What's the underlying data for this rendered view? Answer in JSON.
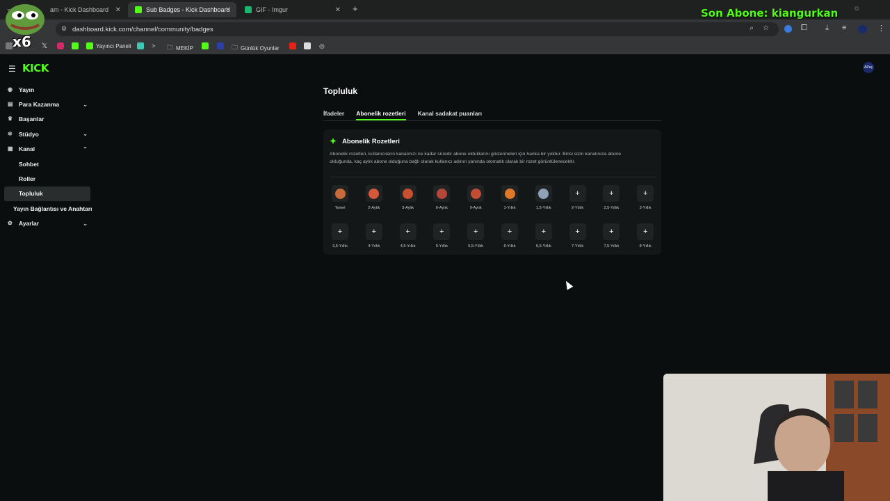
{
  "browser": {
    "tabs": [
      {
        "title": "am - Kick Dashboard",
        "active": false,
        "favicon_color": "#53fc18"
      },
      {
        "title": "Sub Badges - Kick Dashboard",
        "active": true,
        "favicon_color": "#53fc18"
      },
      {
        "title": "GIF - Imgur",
        "active": false,
        "favicon_color": "#1bb76e"
      }
    ],
    "new_tab": "+",
    "url": "dashboard.kick.com/channel/community/badges",
    "bookmarks": [
      {
        "label": "Yayıncı Paneli",
        "icon": "kick-icon"
      },
      {
        "label": "MEKİP",
        "icon": "folder-icon"
      },
      {
        "label": "Günlük Oyunlar",
        "icon": "folder-icon"
      }
    ]
  },
  "overlay": {
    "last_sub": "Son Abone: kiangurkan",
    "multiplier": "x6"
  },
  "app": {
    "brand": "KICK",
    "avatar_text": "APeç"
  },
  "sidebar": {
    "items": [
      {
        "label": "Yayın",
        "icon": "broadcast-icon",
        "chevron": ""
      },
      {
        "label": "Para Kazanma",
        "icon": "money-icon",
        "chevron": "⌄"
      },
      {
        "label": "Başarılar",
        "icon": "trophy-icon",
        "chevron": ""
      },
      {
        "label": "Stüdyo",
        "icon": "studio-icon",
        "chevron": "⌄"
      },
      {
        "label": "Kanal",
        "icon": "channel-icon",
        "chevron": "⌃"
      },
      {
        "label": "Sohbet"
      },
      {
        "label": "Roller"
      },
      {
        "label": "Topluluk"
      },
      {
        "label": "Yayın Bağlantısı ve Anahtarı"
      },
      {
        "label": "Ayarlar",
        "icon": "gear-icon",
        "chevron": "⌄"
      }
    ]
  },
  "main": {
    "title": "Topluluk",
    "tabs": [
      "İfadeler",
      "Abonelik rozetleri",
      "Kanal sadakat puanları"
    ],
    "active_tab": "Abonelik rozetleri",
    "card": {
      "title": "Abonelik Rozetleri",
      "description": "Abonelik rozetleri, kullanıcıların kanalınızı ne kadar süredir abone olduklarını göstermeleri için harika bir yoldur. Birisi sizin kanalınıza abone olduğunda, kaç aylık abone olduğuna bağlı olarak kullanıcı adının yanında otomatik olarak bir rozet görüntülenecektir."
    },
    "badges_row1": [
      {
        "label": "Temel",
        "filled": true,
        "color": "#c96a3a"
      },
      {
        "label": "2-Aylık",
        "filled": true,
        "color": "#d4593a"
      },
      {
        "label": "3-Aylık",
        "filled": true,
        "color": "#c94f2e"
      },
      {
        "label": "6-Aylık",
        "filled": true,
        "color": "#b4483b"
      },
      {
        "label": "9-Aylık",
        "filled": true,
        "color": "#c24c34"
      },
      {
        "label": "1-Yıllık",
        "filled": true,
        "color": "#e0782a"
      },
      {
        "label": "1,5-Yıllık",
        "filled": true,
        "color": "#8fa2b8"
      },
      {
        "label": "2-Yıllık",
        "filled": false
      },
      {
        "label": "2,5-Yıllık",
        "filled": false
      },
      {
        "label": "3-Yıllık",
        "filled": false
      }
    ],
    "badges_row2": [
      {
        "label": "3,5-Yıllık"
      },
      {
        "label": "4-Yıllık"
      },
      {
        "label": "4,5-Yıllık"
      },
      {
        "label": "5-Yıllık"
      },
      {
        "label": "5,5-Yıllık"
      },
      {
        "label": "6-Yıllık"
      },
      {
        "label": "6,5-Yıllık"
      },
      {
        "label": "7-Yıllık"
      },
      {
        "label": "7,5-Yıllık"
      },
      {
        "label": "8-Yıllık"
      }
    ],
    "add_symbol": "+"
  }
}
